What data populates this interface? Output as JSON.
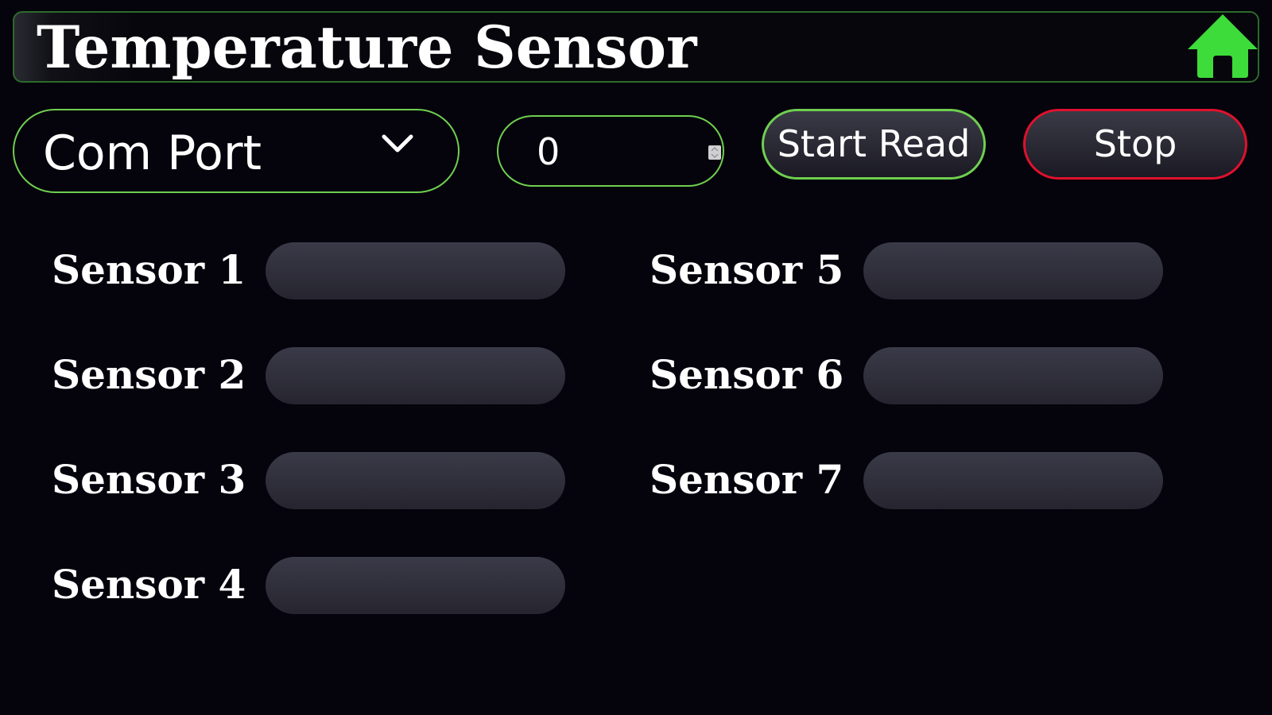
{
  "header": {
    "title": "Temperature Sensor",
    "home_icon": "home-icon",
    "accent_color": "#3ddc3a"
  },
  "controls": {
    "com_port_label": "Com Port",
    "chevron_icon": "chevron-down-icon",
    "spin_value": "0",
    "start_label": "Start Read",
    "stop_label": "Stop",
    "start_border_color": "#6fcf4f",
    "stop_border_color": "#e0112d"
  },
  "sensors": [
    {
      "label": "Sensor 1",
      "value": ""
    },
    {
      "label": "Sensor 2",
      "value": ""
    },
    {
      "label": "Sensor 3",
      "value": ""
    },
    {
      "label": "Sensor 4",
      "value": ""
    },
    {
      "label": "Sensor 5",
      "value": ""
    },
    {
      "label": "Sensor 6",
      "value": ""
    },
    {
      "label": "Sensor 7",
      "value": ""
    }
  ]
}
